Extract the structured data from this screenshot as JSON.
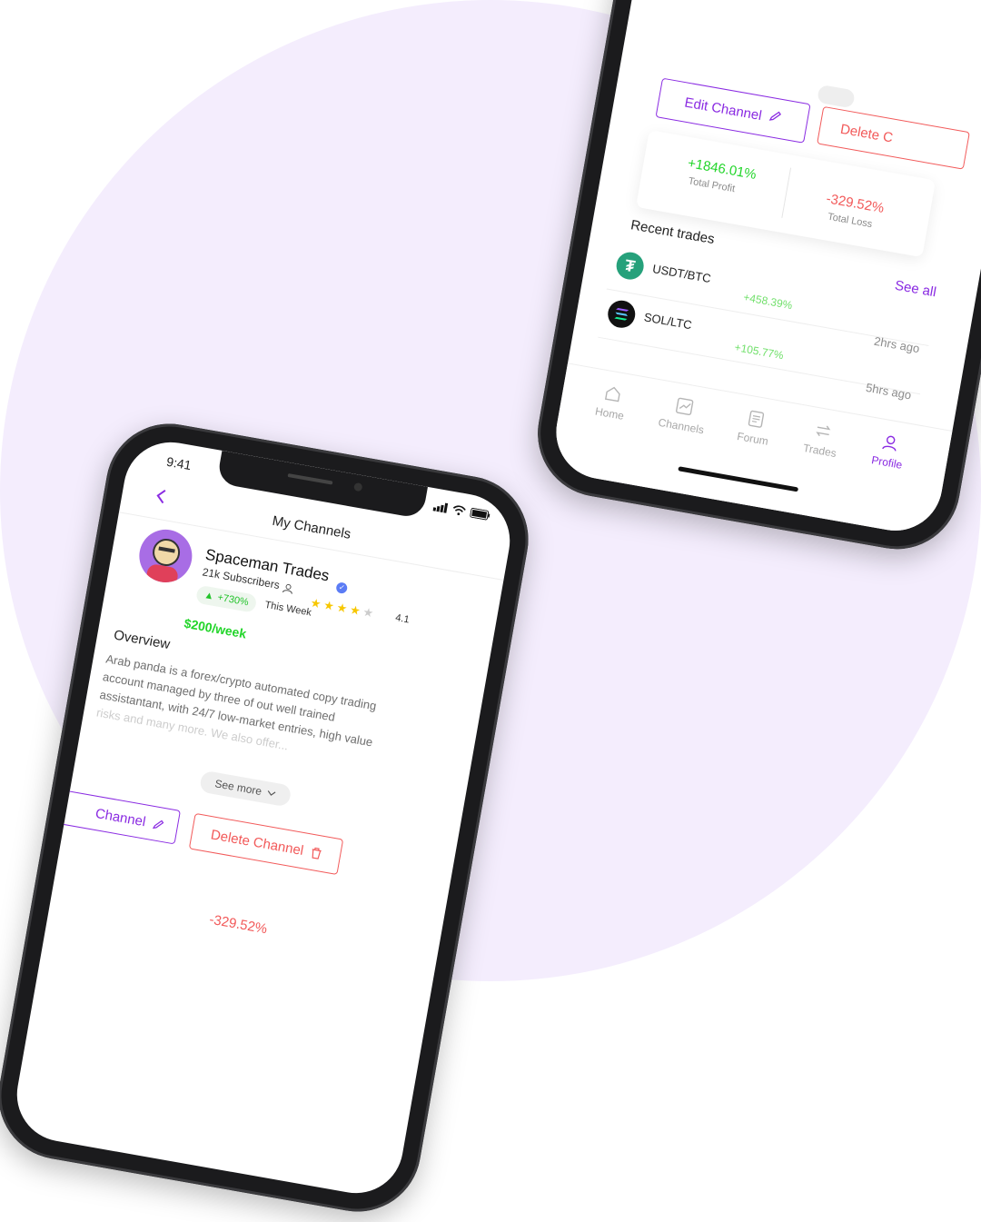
{
  "status_bar": {
    "time": "9:41"
  },
  "channel_page": {
    "title": "My Channels",
    "channel_name": "Spaceman Trades",
    "subscribers": "21k Subscribers",
    "growth": "+730%",
    "growth_period": "This Week",
    "rating": "4.1",
    "rating_stars": 4,
    "price": "$200/week",
    "overview_heading": "Overview",
    "overview_text": [
      "Arab panda is a forex/crypto automated copy trading",
      "account managed by three of out well trained",
      "assistantant, with 24/7 low-market entries, high value",
      "risks and many more. We also offer..."
    ],
    "see_more": "See more",
    "edit_channel": "Edit Channel",
    "edit_channel_partial": "Channel",
    "delete_channel": "Delete Channel",
    "delete_channel_partial": "Delete C",
    "total_profit_value": "+1846.01%",
    "total_profit_label": "Total Profit",
    "total_loss_value": "-329.52%",
    "total_loss_label": "Total Loss"
  },
  "recent_trades": {
    "heading": "Recent trades",
    "see_all": "See all",
    "items": [
      {
        "pair": "USDT/BTC",
        "change": "+458.39%",
        "time": ""
      },
      {
        "pair": "SOL/LTC",
        "change": "+105.77%",
        "time": "2hrs ago"
      },
      {
        "pair": "",
        "change": "",
        "time": "5hrs ago"
      }
    ]
  },
  "nav": {
    "items": [
      {
        "label": "Home",
        "icon": "home-icon",
        "active": false
      },
      {
        "label": "Channels",
        "icon": "chart-icon",
        "active": false
      },
      {
        "label": "Forum",
        "icon": "document-icon",
        "active": false
      },
      {
        "label": "Trades",
        "icon": "swap-icon",
        "active": false
      },
      {
        "label": "Profile",
        "icon": "user-icon",
        "active": true
      }
    ]
  },
  "colors": {
    "accent": "#8a2be2",
    "danger": "#f25a5a",
    "profit": "#22d52a",
    "background": "#f4edfd",
    "tether": "#26a17b"
  }
}
